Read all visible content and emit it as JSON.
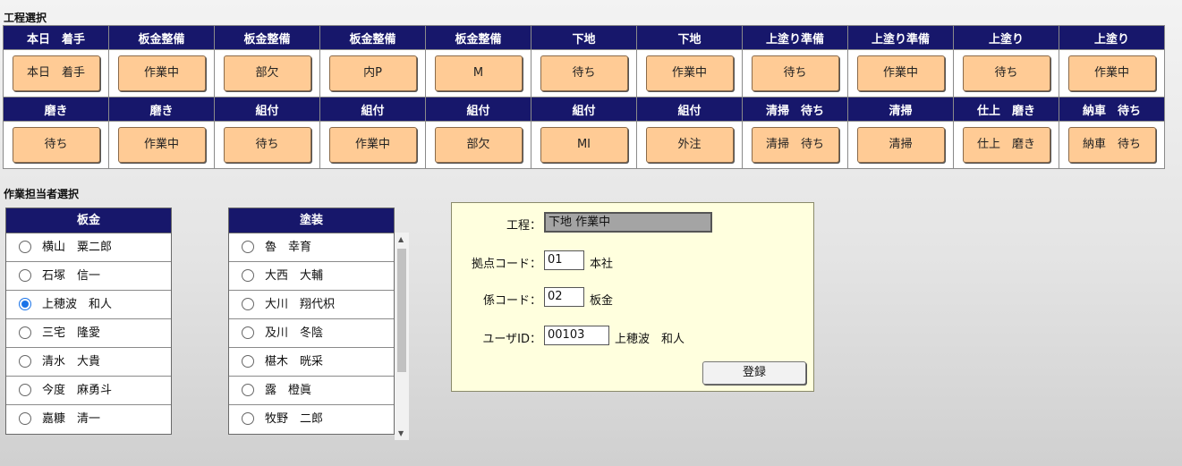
{
  "process_section": {
    "title": "工程選択",
    "row1": [
      {
        "header": "本日　着手",
        "button": "本日　着手"
      },
      {
        "header": "板金整備",
        "button": "作業中"
      },
      {
        "header": "板金整備",
        "button": "部欠"
      },
      {
        "header": "板金整備",
        "button": "内P"
      },
      {
        "header": "板金整備",
        "button": "M"
      },
      {
        "header": "下地",
        "button": "待ち"
      },
      {
        "header": "下地",
        "button": "作業中"
      },
      {
        "header": "上塗り準備",
        "button": "待ち"
      },
      {
        "header": "上塗り準備",
        "button": "作業中"
      },
      {
        "header": "上塗り",
        "button": "待ち"
      },
      {
        "header": "上塗り",
        "button": "作業中"
      }
    ],
    "row2": [
      {
        "header": "磨き",
        "button": "待ち"
      },
      {
        "header": "磨き",
        "button": "作業中"
      },
      {
        "header": "組付",
        "button": "待ち"
      },
      {
        "header": "組付",
        "button": "作業中"
      },
      {
        "header": "組付",
        "button": "部欠"
      },
      {
        "header": "組付",
        "button": "MI"
      },
      {
        "header": "組付",
        "button": "外注"
      },
      {
        "header": "清掃　待ち",
        "button": "清掃　待ち"
      },
      {
        "header": "清掃",
        "button": "清掃"
      },
      {
        "header": "仕上　磨き",
        "button": "仕上　磨き"
      },
      {
        "header": "納車　待ち",
        "button": "納車　待ち"
      }
    ]
  },
  "worker_section": {
    "title": "作業担当者選択",
    "bankin": {
      "header": "板金",
      "people": [
        {
          "name": "横山　粟二郎",
          "selected": false
        },
        {
          "name": "石塚　信一",
          "selected": false
        },
        {
          "name": "上穂波　和人",
          "selected": true
        },
        {
          "name": "三宅　隆愛",
          "selected": false
        },
        {
          "name": "清水　大貴",
          "selected": false
        },
        {
          "name": "今度　麻勇斗",
          "selected": false
        },
        {
          "name": "嘉糠　清一",
          "selected": false
        }
      ]
    },
    "tosou": {
      "header": "塗装",
      "people": [
        {
          "name": "魯　幸育",
          "selected": false
        },
        {
          "name": "大西　大輔",
          "selected": false
        },
        {
          "name": "大川　翔代枳",
          "selected": false
        },
        {
          "name": "及川　冬陰",
          "selected": false
        },
        {
          "name": "椹木　晄采",
          "selected": false
        },
        {
          "name": "露　橙眞",
          "selected": false
        },
        {
          "name": "牧野　二郎",
          "selected": false
        }
      ]
    }
  },
  "form": {
    "process_label": "工程：",
    "process_value": "下地 作業中",
    "base_code_label": "拠点コード：",
    "base_code_value": "01",
    "base_name": "本社",
    "section_code_label": "係コード：",
    "section_code_value": "02",
    "section_name": "板金",
    "user_id_label": "ユーザID：",
    "user_id_value": "00103",
    "user_name": "上穂波　和人",
    "register_button": "登録"
  }
}
